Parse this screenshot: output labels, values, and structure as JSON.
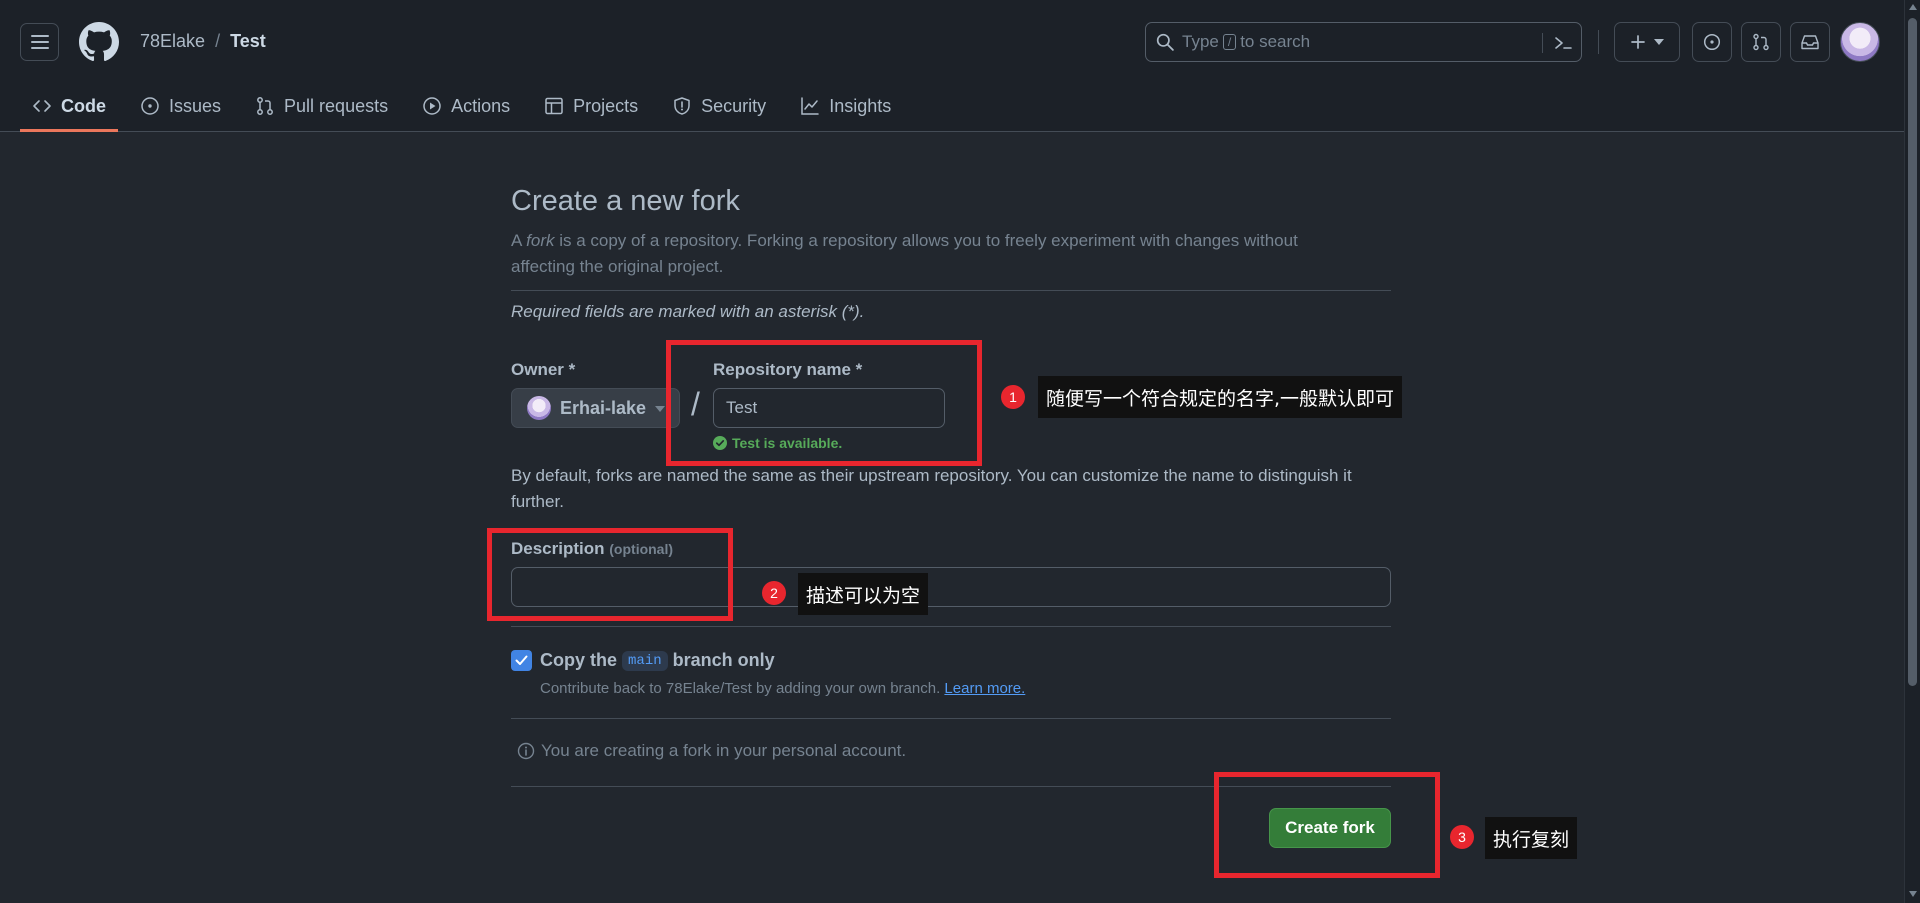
{
  "header": {
    "owner": "78Elake",
    "separator": "/",
    "repo": "Test",
    "search_prefix": "Type",
    "search_key": "/",
    "search_suffix": "to search"
  },
  "tabs": [
    {
      "label": "Code",
      "icon": "code-icon",
      "active": true
    },
    {
      "label": "Issues",
      "icon": "issue-icon"
    },
    {
      "label": "Pull requests",
      "icon": "pull-request-icon"
    },
    {
      "label": "Actions",
      "icon": "play-icon"
    },
    {
      "label": "Projects",
      "icon": "table-icon"
    },
    {
      "label": "Security",
      "icon": "shield-icon"
    },
    {
      "label": "Insights",
      "icon": "graph-icon"
    }
  ],
  "form": {
    "title": "Create a new fork",
    "lead_prefix": "A",
    "lead_em": "fork",
    "lead_rest": "is a copy of a repository. Forking a repository allows you to freely experiment with changes without affecting the original project.",
    "required_note": "Required fields are marked with an asterisk (*).",
    "owner_label": "Owner *",
    "owner_value": "Erhai-lake",
    "slash": "/",
    "repo_label": "Repository name *",
    "repo_value": "Test",
    "available": "Test is available.",
    "help_text": "By default, forks are named the same as their upstream repository. You can customize the name to distinguish it further.",
    "description_label": "Description",
    "description_optional": "(optional)",
    "description_value": "",
    "copy_prefix": "Copy the",
    "copy_branch": "main",
    "copy_suffix": "branch only",
    "copy_checked": true,
    "copy_help": "Contribute back to 78Elake/Test by adding your own branch.",
    "learn_more": "Learn more.",
    "info": "You are creating a fork in your personal account.",
    "create_button": "Create fork"
  },
  "annotations": [
    {
      "number": "1",
      "text": "随便写一个符合规定的名字,一般默认即可"
    },
    {
      "number": "2",
      "text": "描述可以为空"
    },
    {
      "number": "3",
      "text": "执行复刻"
    }
  ],
  "colors": {
    "accent_red": "#e8262e",
    "primary_green": "#347d39",
    "link_blue": "#539bf5",
    "tab_underline": "#ec775c"
  }
}
